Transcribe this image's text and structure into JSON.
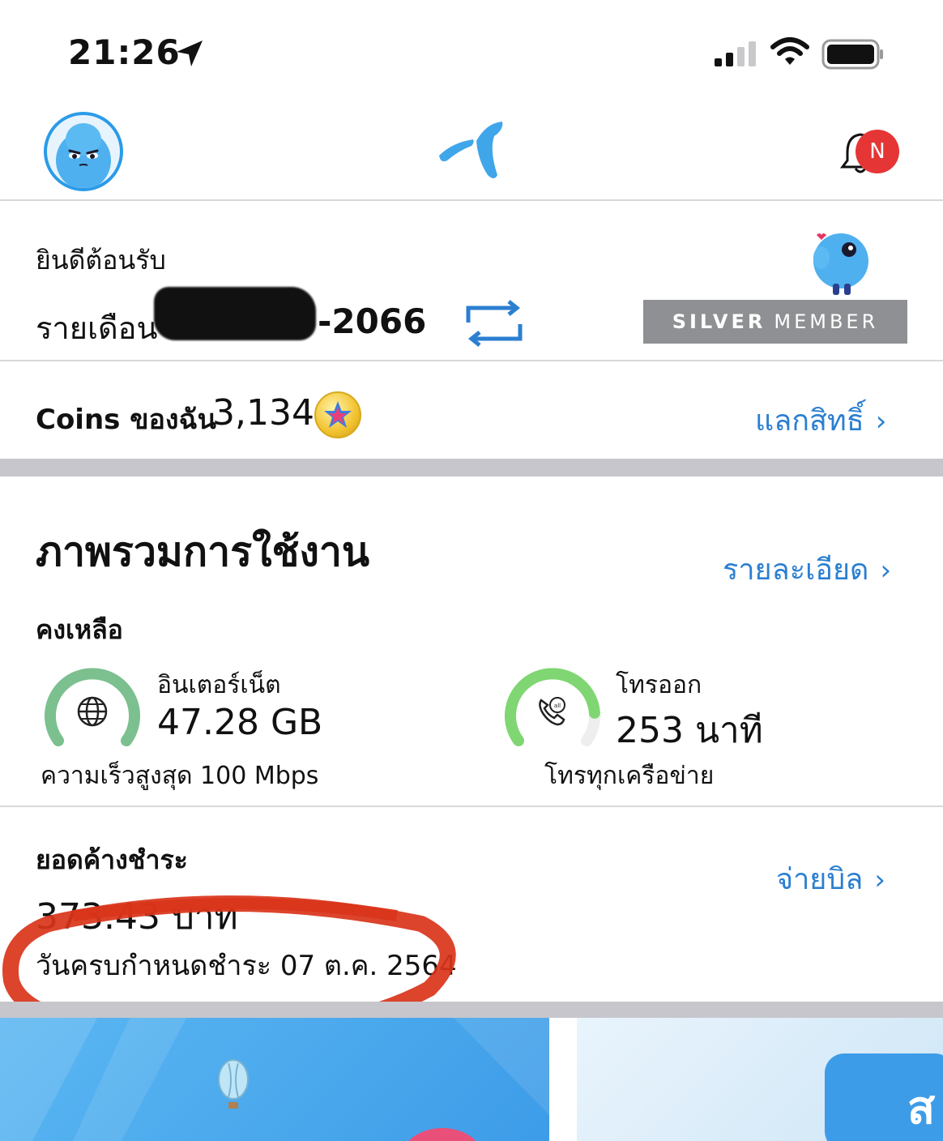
{
  "status_bar": {
    "time": "21:26"
  },
  "header": {
    "notification_badge": "N"
  },
  "account": {
    "welcome": "ยินดีต้อนรับ",
    "plan_label": "รายเดือน",
    "number_suffix": "-2066",
    "member_tier_1": "SILVER",
    "member_tier_2": "MEMBER"
  },
  "coins": {
    "label": "Coins ของฉัน",
    "value": "3,134",
    "redeem_link": "แลกสิทธิ์"
  },
  "overview": {
    "title": "ภาพรวมการใช้งาน",
    "details_link": "รายละเอียด",
    "remaining_label": "คงเหลือ",
    "internet": {
      "label": "อินเตอร์เน็ต",
      "value": "47.28 GB",
      "sub": "ความเร็วสูงสุด 100 Mbps",
      "level": 1.0,
      "color": "#7cc08f"
    },
    "calls": {
      "label": "โทรออก",
      "value": "253 นาที",
      "sub": "โทรทุกเครือข่าย",
      "level": 0.84,
      "color": "#7fd672"
    }
  },
  "billing": {
    "label": "ยอดค้างชำระ",
    "amount": "373.43 บาท",
    "pay_link": "จ่ายบิล",
    "due_date": "วันครบกำหนดชำระ 07 ต.ค. 2564"
  },
  "banner": {
    "tile_text": "ส"
  },
  "colors": {
    "accent": "#2b7fd0",
    "brand": "#2b9be8",
    "badge_red": "#e53535",
    "annotation_red": "#d9341a"
  }
}
